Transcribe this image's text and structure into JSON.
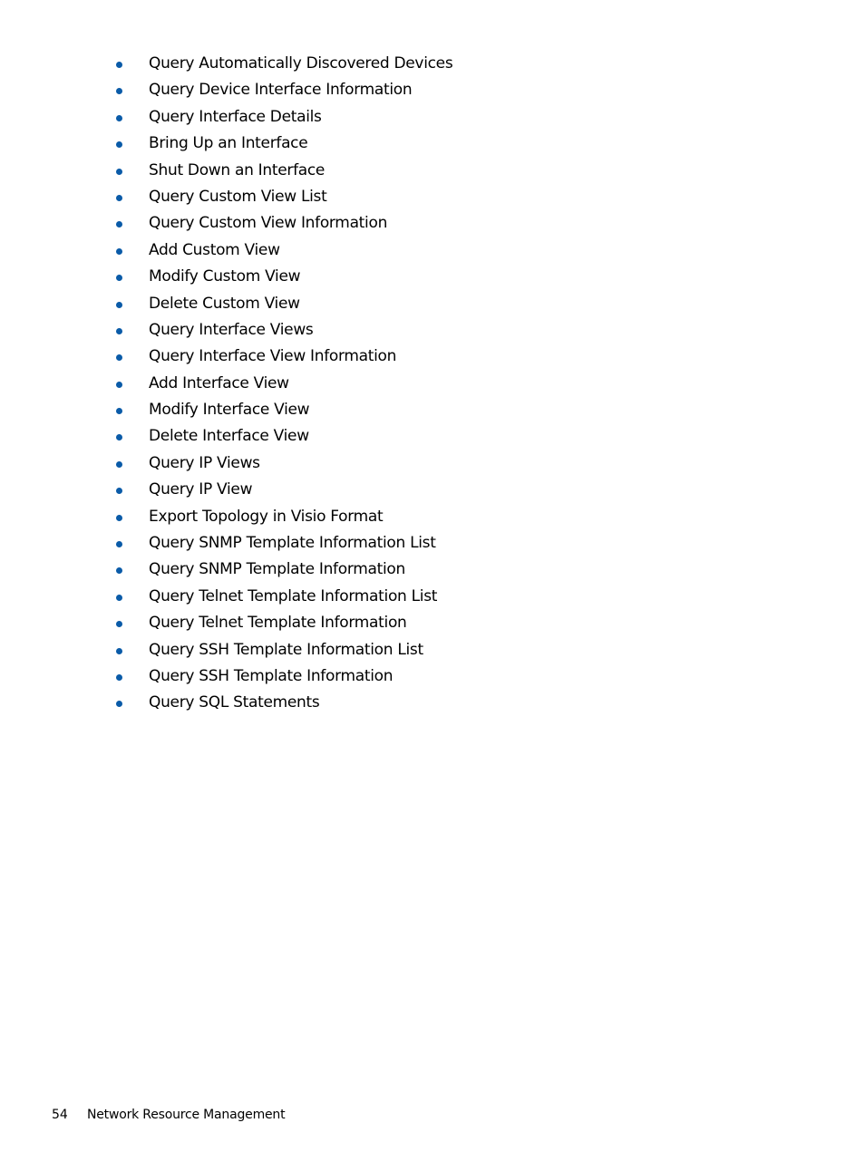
{
  "items": [
    "Query Automatically Discovered Devices",
    "Query Device Interface Information",
    "Query Interface Details",
    "Bring Up an Interface",
    "Shut Down an Interface",
    "Query Custom View List",
    "Query Custom View Information",
    "Add Custom View",
    "Modify Custom View",
    "Delete Custom View",
    "Query Interface Views",
    "Query Interface View Information",
    "Add Interface View",
    "Modify Interface View",
    "Delete Interface View",
    "Query IP Views",
    "Query IP View",
    "Export Topology in Visio Format",
    "Query SNMP Template Information List",
    "Query SNMP Template Information",
    "Query Telnet Template Information List",
    "Query Telnet Template Information",
    "Query SSH Template Information List",
    "Query SSH Template Information",
    "Query SQL Statements"
  ],
  "bullet_color": "#0a5ba8",
  "footer": {
    "page_number": "54",
    "section_title": "Network Resource Management"
  }
}
